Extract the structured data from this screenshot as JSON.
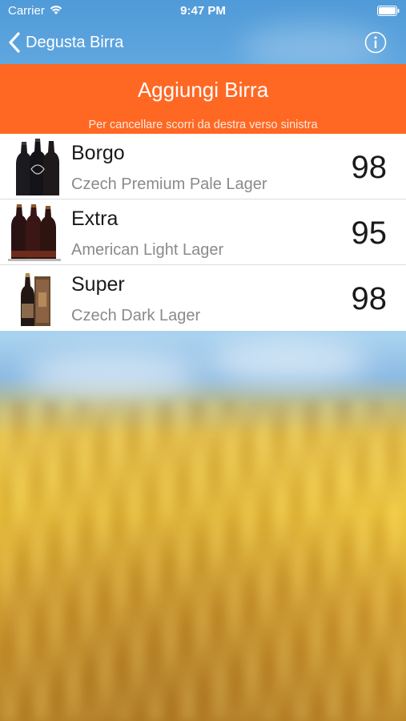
{
  "status_bar": {
    "carrier": "Carrier",
    "time": "9:47 PM",
    "wifi_icon": "wifi-icon",
    "battery_icon": "battery-icon"
  },
  "nav": {
    "back_label": "Degusta Birra",
    "back_icon": "chevron-left-icon",
    "info_icon": "info-icon"
  },
  "header": {
    "title": "Aggiungi Birra",
    "hint": "Per cancellare scorri da destra verso sinistra",
    "background_color": "#ff6823"
  },
  "beers": [
    {
      "name": "Borgo",
      "style": "Czech Premium Pale Lager",
      "score": "98"
    },
    {
      "name": "Extra",
      "style": "American Light Lager",
      "score": "95"
    },
    {
      "name": "Super",
      "style": "Czech Dark Lager",
      "score": "98"
    }
  ]
}
